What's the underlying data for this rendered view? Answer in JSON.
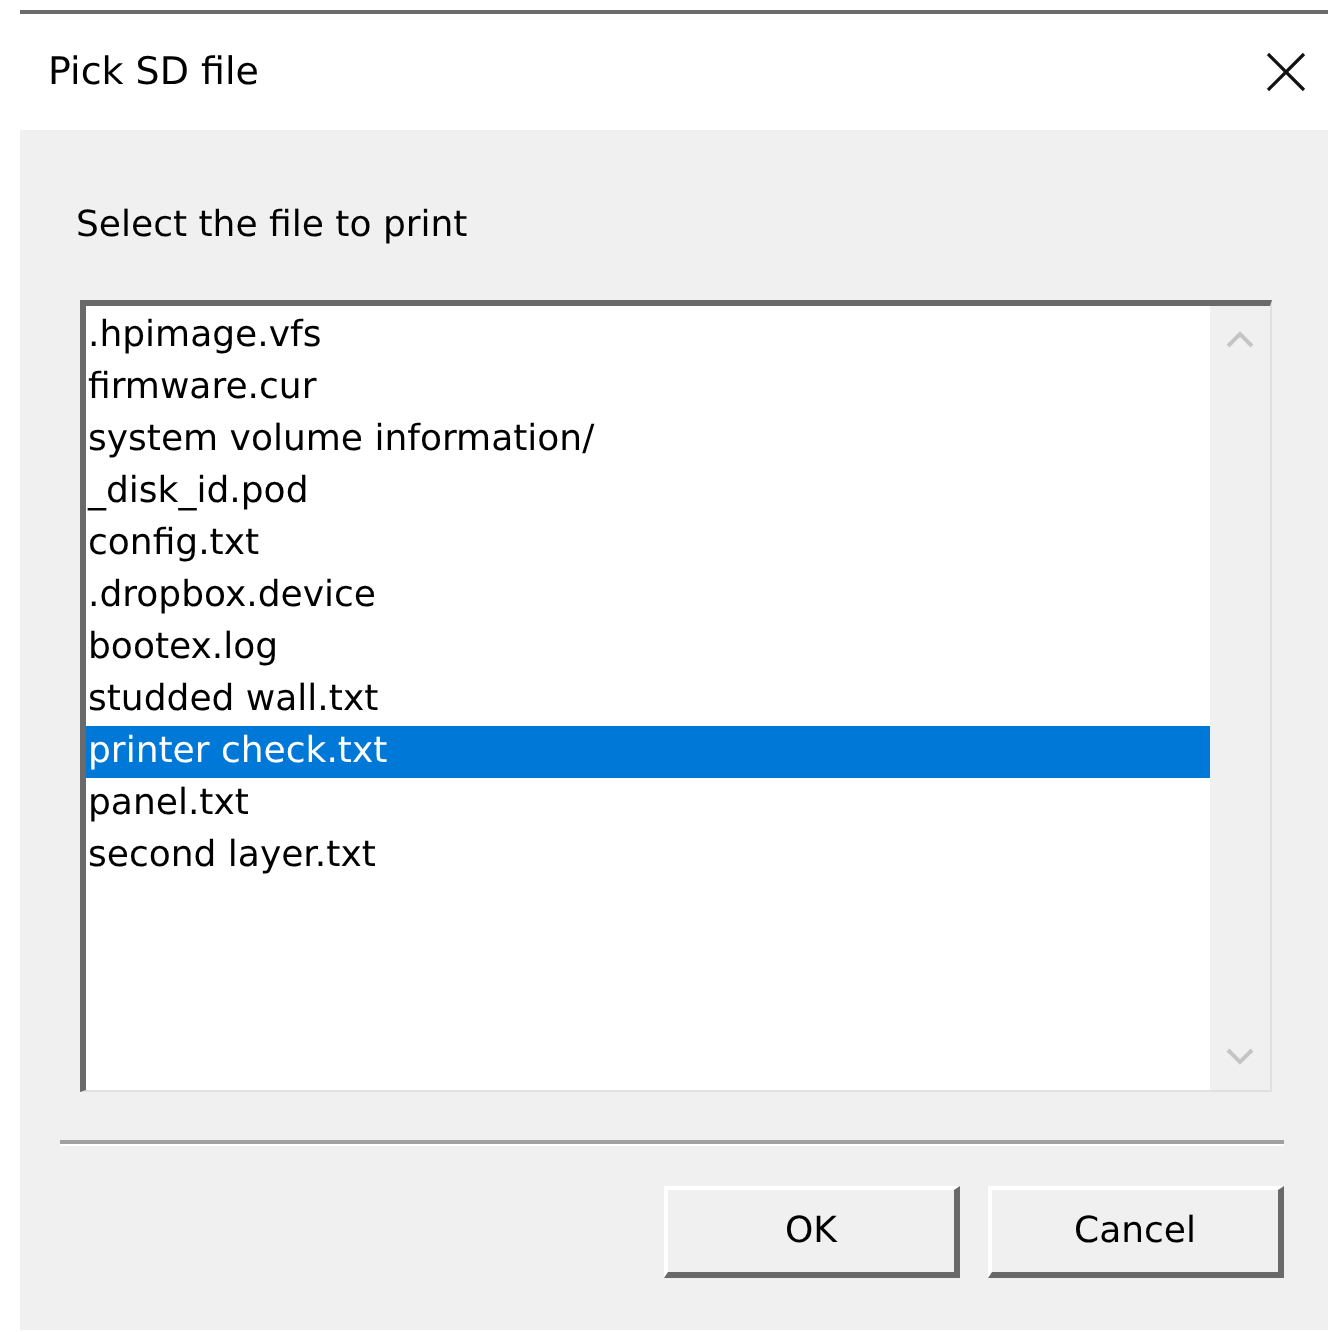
{
  "window": {
    "title": "Pick SD file"
  },
  "prompt": "Select the file to print",
  "files": [
    {
      "name": ".hpimage.vfs",
      "selected": false
    },
    {
      "name": "firmware.cur",
      "selected": false
    },
    {
      "name": "system volume information/",
      "selected": false
    },
    {
      "name": "_disk_id.pod",
      "selected": false
    },
    {
      "name": "config.txt",
      "selected": false
    },
    {
      "name": ".dropbox.device",
      "selected": false
    },
    {
      "name": "bootex.log",
      "selected": false
    },
    {
      "name": "studded wall.txt",
      "selected": false
    },
    {
      "name": "printer check.txt",
      "selected": true
    },
    {
      "name": "panel.txt",
      "selected": false
    },
    {
      "name": "second layer.txt",
      "selected": false
    }
  ],
  "buttons": [
    "OK",
    "Cancel"
  ]
}
